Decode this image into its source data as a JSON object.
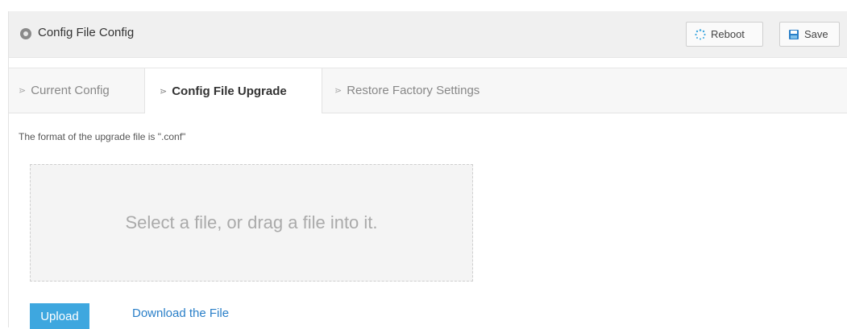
{
  "header": {
    "title": "Config File Config",
    "reboot_label": "Reboot",
    "save_label": "Save"
  },
  "tabs": [
    {
      "label": "Current Config",
      "active": false
    },
    {
      "label": "Config File Upgrade",
      "active": true
    },
    {
      "label": "Restore Factory Settings",
      "active": false
    }
  ],
  "content": {
    "hint": "The format of the upgrade file is \".conf\"",
    "dropzone_text": "Select a file, or drag a file into it.",
    "upload_label": "Upload",
    "download_label": "Download the File"
  },
  "colors": {
    "accent": "#3ea7df",
    "link": "#2a7fc8"
  },
  "icons": {
    "title": "location-pin-icon",
    "reboot": "spinner-icon",
    "save": "floppy-disk-icon",
    "tab_marker": "chevron-right-icon"
  }
}
